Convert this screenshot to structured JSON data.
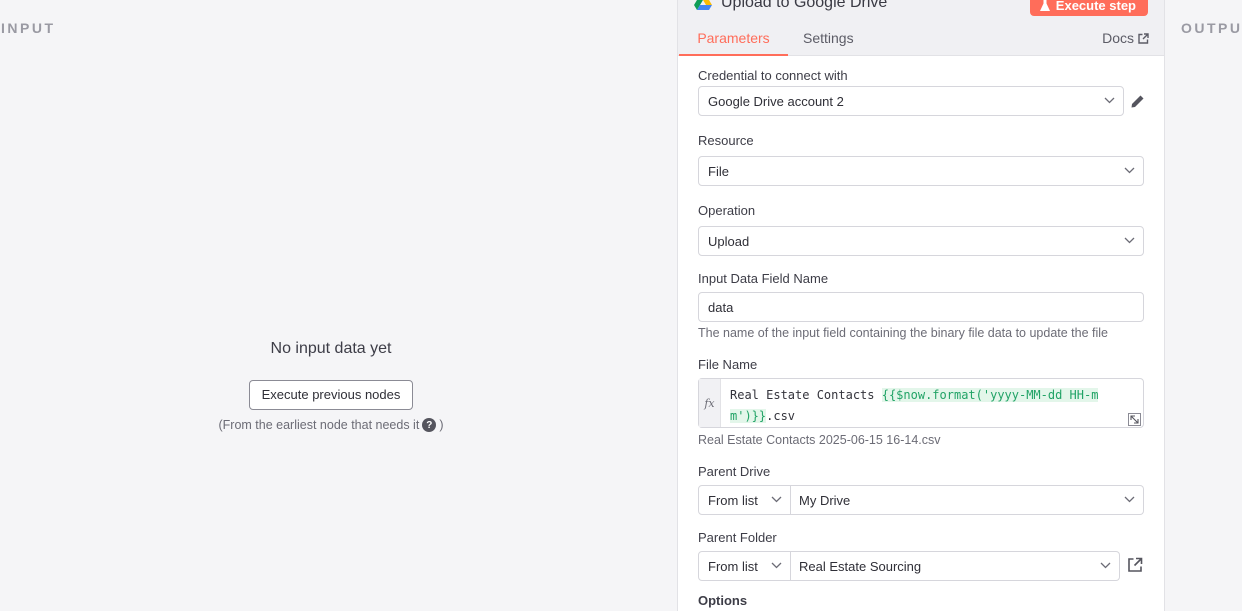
{
  "input_panel": {
    "label": "INPUT",
    "empty_title": "No input data yet",
    "execute_button": "Execute previous nodes",
    "hint_before": "(From the earliest node that needs it",
    "hint_after": ")"
  },
  "output_panel": {
    "label": "OUTPU"
  },
  "node": {
    "title": "Upload to Google Drive",
    "execute_step": "Execute step",
    "tabs": {
      "parameters": "Parameters",
      "settings": "Settings",
      "docs": "Docs"
    }
  },
  "fields": {
    "credential": {
      "label": "Credential to connect with",
      "value": "Google Drive account 2"
    },
    "resource": {
      "label": "Resource",
      "value": "File"
    },
    "operation": {
      "label": "Operation",
      "value": "Upload"
    },
    "input_field": {
      "label": "Input Data Field Name",
      "value": "data",
      "hint": "The name of the input field containing the binary file data to update the file"
    },
    "file_name": {
      "label": "File Name",
      "fx": "fx",
      "expr_prefix": "Real Estate Contacts ",
      "expr_code": "{{$now.format('yyyy-MM-dd HH-mm')}}",
      "expr_suffix": ".csv",
      "preview": "Real Estate Contacts 2025-06-15 16-14.csv"
    },
    "parent_drive": {
      "label": "Parent Drive",
      "mode": "From list",
      "value": "My Drive"
    },
    "parent_folder": {
      "label": "Parent Folder",
      "mode": "From list",
      "value": "Real Estate Sourcing"
    },
    "options": {
      "label": "Options"
    }
  },
  "colors": {
    "accent": "#ff6d5a",
    "expression_green": "#21a366"
  }
}
